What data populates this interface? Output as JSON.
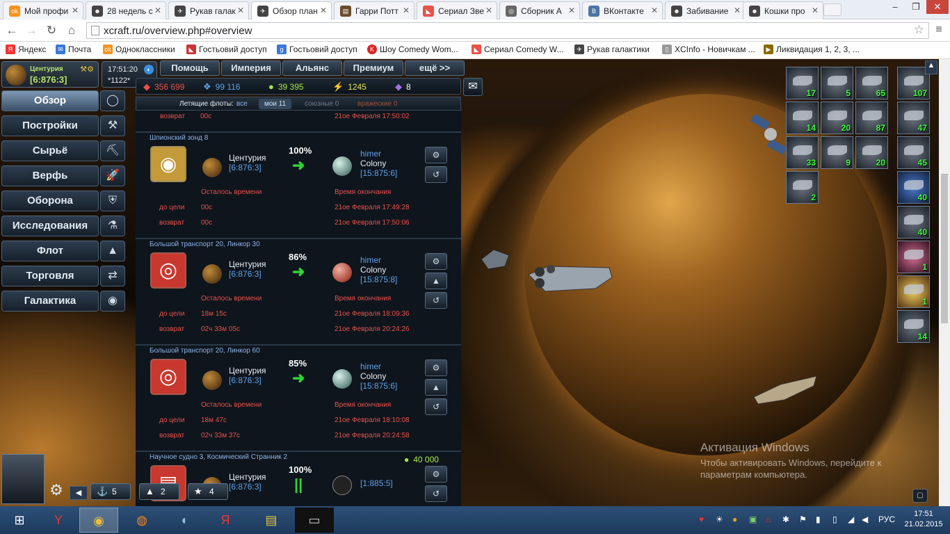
{
  "browser": {
    "tabs": [
      {
        "label": "Мой профи",
        "fav": "ok",
        "color": "#f7931e"
      },
      {
        "label": "28 недель с",
        "fav": "☻",
        "color": "#444"
      },
      {
        "label": "Рукав галак",
        "fav": "✈",
        "color": "#444"
      },
      {
        "label": "Обзор план",
        "fav": "✈",
        "color": "#444"
      },
      {
        "label": "Гарри Потт",
        "fav": "▤",
        "color": "#6b4b2a"
      },
      {
        "label": "Сериал Зве",
        "fav": "◣",
        "color": "#e8524a"
      },
      {
        "label": "Сборник А",
        "fav": "◎",
        "color": "#666"
      },
      {
        "label": "ВКонтакте",
        "fav": "B",
        "color": "#4c75a3"
      },
      {
        "label": "Забивание",
        "fav": "☻",
        "color": "#444"
      },
      {
        "label": "Кошки про",
        "fav": "☻",
        "color": "#444"
      }
    ],
    "url": "xcraft.ru/overview.php#overview",
    "bookmarks": [
      {
        "label": "Яндекс",
        "icon": "Я",
        "color": "#e32"
      },
      {
        "label": "Почта",
        "icon": "✉",
        "color": "#3b78d8"
      },
      {
        "label": "Одноклассники",
        "icon": "ok",
        "color": "#f7931e"
      },
      {
        "label": "Гостьовий доступ",
        "icon": "◣",
        "color": "#c33"
      },
      {
        "label": "Гостьовий доступ",
        "icon": "g",
        "color": "#3b78d8"
      },
      {
        "label": "Шоу Comedy Wom...",
        "icon": "K",
        "color": "#d22"
      },
      {
        "label": "Сериал Comedy W...",
        "icon": "◣",
        "color": "#e8524a"
      },
      {
        "label": "Рукав галактики",
        "icon": "✈",
        "color": "#444"
      },
      {
        "label": "XCInfo - Новичкам ...",
        "icon": "▯",
        "color": "#999"
      },
      {
        "label": "Ликвидация 1, 2, 3, ...",
        "icon": "▶",
        "color": "#8a6a00"
      }
    ]
  },
  "game": {
    "planet_name": "Центурия",
    "planet_coords": "[6:876:3]",
    "clock_time": "17:51:20",
    "server": "*1122*",
    "left_menu": [
      {
        "label": "Обзор",
        "icon": "◯"
      },
      {
        "label": "Постройки",
        "icon": "⚒"
      },
      {
        "label": "Сырьё",
        "icon": "⛏"
      },
      {
        "label": "Верфь",
        "icon": "🚀"
      },
      {
        "label": "Оборона",
        "icon": "⛨"
      },
      {
        "label": "Исследования",
        "icon": "⚗"
      },
      {
        "label": "Флот",
        "icon": "▲"
      },
      {
        "label": "Торговля",
        "icon": "⇄"
      },
      {
        "label": "Галактика",
        "icon": "◉"
      }
    ],
    "top_menu": [
      "Помощь",
      "Империя",
      "Альянс",
      "Премиум",
      "ещё >>"
    ],
    "resources": [
      {
        "value": "356 699",
        "icon": "◆",
        "color": "#e8524a"
      },
      {
        "value": "99 116",
        "icon": "❖",
        "color": "#5ea3e8"
      },
      {
        "value": "39 395",
        "icon": "●",
        "color": "#a6e84a"
      },
      {
        "value": "1245",
        "icon": "⚡",
        "color": "#e8e84a"
      },
      {
        "value": "8",
        "icon": "◆",
        "color": "#fff"
      }
    ],
    "flying_label": "Летящие флоты:",
    "filter": {
      "all": "все",
      "mine": "мои 11",
      "allied": "союзные 0",
      "enemy": "вражеские 0"
    },
    "top_partial": {
      "label": "возврат",
      "value": "00с",
      "date": "21ое Февраля 17:50:02"
    },
    "labels": {
      "remaining": "Осталось времени",
      "end": "Время окончания",
      "to_target": "до цели",
      "return": "возврат"
    },
    "fleets": [
      {
        "title": "Шпионский зонд 8",
        "origin_name": "Центурия",
        "origin_coords": "[6:876:3]",
        "percent": "100%",
        "dest_name": "himer",
        "dest_colony": "Colony",
        "dest_coords": "[15:875:6]",
        "to_target": "00с",
        "return": "00с",
        "end_target": "21ое Февраля 17:49:28",
        "end_return": "21ое Февраля 17:50:06",
        "mission_icon": "◉",
        "mission_color": "#c49a3a",
        "dest_color": "#7fc0b4"
      },
      {
        "title": "Большой транспорт 20, Линкор 30",
        "origin_name": "Центурия",
        "origin_coords": "[6:876:3]",
        "percent": "86%",
        "dest_name": "himer",
        "dest_colony": "Colony",
        "dest_coords": "[15:875:8]",
        "to_target": "18м 15с",
        "return": "02ч 33м 05с",
        "end_target": "21ое Февраля 18:09:36",
        "end_return": "21ое Февраля 20:24:26",
        "mission_icon": "◎",
        "mission_color": "#c9382e",
        "dest_color": "#d13a2e"
      },
      {
        "title": "Большой транспорт 20, Линкор 60",
        "origin_name": "Центурия",
        "origin_coords": "[6:876:3]",
        "percent": "85%",
        "dest_name": "himer",
        "dest_colony": "Colony",
        "dest_coords": "[15:875:6]",
        "to_target": "18м 47с",
        "return": "02ч 33м 37с",
        "end_target": "21ое Февраля 18:10:08",
        "end_return": "21ое Февраля 20:24:58",
        "mission_icon": "◎",
        "mission_color": "#c9382e",
        "dest_color": "#7fc0b4"
      },
      {
        "title": "Научное судно 3, Космический Странник 2",
        "origin_name": "Центурия",
        "origin_coords": "[6:876:3]",
        "percent": "100%",
        "dest_coords": "[1:885:5]",
        "bonus": "40 000",
        "mission_icon": "▤",
        "mission_color": "#c9382e"
      }
    ],
    "ship_thumbs_a": [
      "17",
      "5",
      "65",
      "14",
      "20",
      "87",
      "33",
      "9",
      "20",
      "2"
    ],
    "ship_thumbs_b": [
      "107",
      "47",
      "45",
      "40",
      "40",
      "1",
      "1",
      "14"
    ],
    "bottom_stats": [
      {
        "icon": "⚓",
        "value": "5"
      },
      {
        "icon": "▲",
        "value": "2"
      },
      {
        "icon": "★",
        "value": "4"
      }
    ],
    "activation_title": "Активация Windows",
    "activation_text": "Чтобы активировать Windows, перейдите к параметрам компьютера."
  },
  "taskbar": {
    "lang": "РУС",
    "time": "17:51",
    "date": "21.02.2015"
  }
}
